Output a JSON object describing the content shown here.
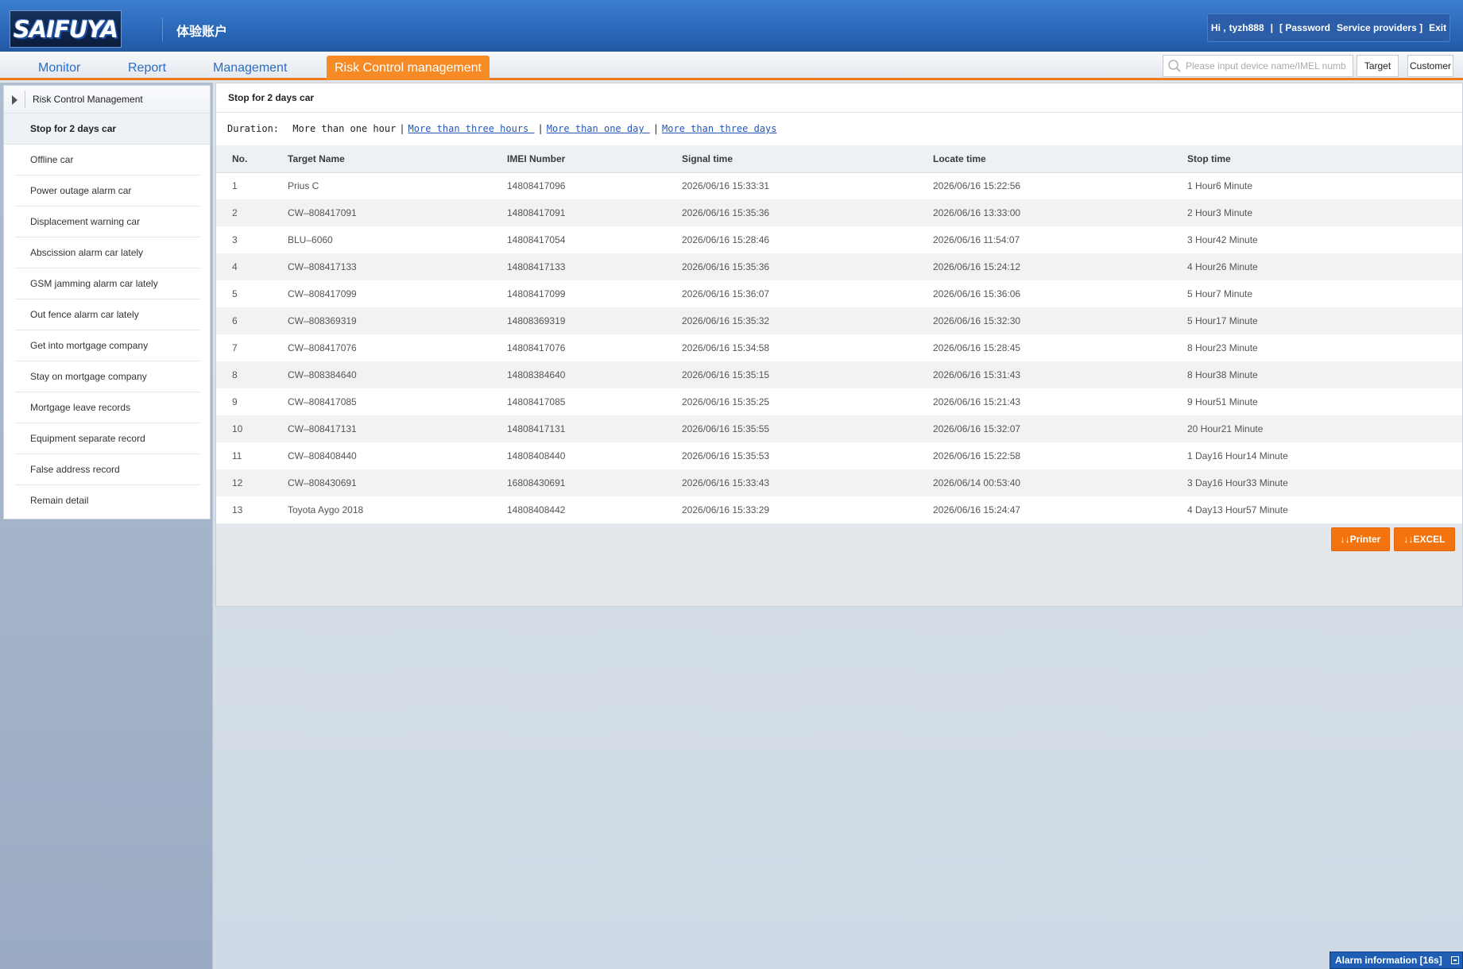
{
  "header": {
    "logo_text": "SAIFUYA",
    "account_name": "体验账户",
    "greeting": "Hi ,",
    "username": "tyzh888",
    "separator": "|",
    "password_link": "[ Password",
    "service_link": "Service providers ]",
    "exit_link": "Exit"
  },
  "nav": {
    "tabs": [
      {
        "label": "Monitor"
      },
      {
        "label": "Report"
      },
      {
        "label": "Management"
      },
      {
        "label": "Risk Control management"
      }
    ],
    "search_placeholder": "Please input device name/IMEL numb",
    "target_button": "Target",
    "customer_button": "Customer"
  },
  "sidebar": {
    "header": "Risk Control Management",
    "items": [
      {
        "label": "Stop for 2 days car"
      },
      {
        "label": "Offline car"
      },
      {
        "label": "Power outage alarm car"
      },
      {
        "label": "Displacement warning car"
      },
      {
        "label": "Abscission alarm car lately"
      },
      {
        "label": "GSM jamming alarm car lately"
      },
      {
        "label": "Out fence alarm car lately"
      },
      {
        "label": "Get into mortgage company"
      },
      {
        "label": "Stay on mortgage company"
      },
      {
        "label": "Mortgage leave records"
      },
      {
        "label": "Equipment separate record"
      },
      {
        "label": "False address record"
      },
      {
        "label": "Remain detail"
      }
    ]
  },
  "main": {
    "title": "Stop for 2 days car",
    "duration_label": "Duration:",
    "duration_options": [
      "More than one hour",
      "More than three hours ",
      "More than one day ",
      "More than three days"
    ],
    "columns": [
      "No.",
      "Target Name",
      "IMEI Number",
      "Signal time",
      "Locate time",
      "Stop time"
    ],
    "rows": [
      [
        "1",
        "Prius C",
        "14808417096",
        "2026/06/16 15:33:31",
        "2026/06/16 15:22:56",
        "1 Hour6 Minute"
      ],
      [
        "2",
        "CW–808417091",
        "14808417091",
        "2026/06/16 15:35:36",
        "2026/06/16 13:33:00",
        "2 Hour3 Minute"
      ],
      [
        "3",
        "BLU–6060",
        "14808417054",
        "2026/06/16 15:28:46",
        "2026/06/16 11:54:07",
        "3 Hour42 Minute"
      ],
      [
        "4",
        "CW–808417133",
        "14808417133",
        "2026/06/16 15:35:36",
        "2026/06/16 15:24:12",
        "4 Hour26 Minute"
      ],
      [
        "5",
        "CW–808417099",
        "14808417099",
        "2026/06/16 15:36:07",
        "2026/06/16 15:36:06",
        "5 Hour7 Minute"
      ],
      [
        "6",
        "CW–808369319",
        "14808369319",
        "2026/06/16 15:35:32",
        "2026/06/16 15:32:30",
        "5 Hour17 Minute"
      ],
      [
        "7",
        "CW–808417076",
        "14808417076",
        "2026/06/16 15:34:58",
        "2026/06/16 15:28:45",
        "8 Hour23 Minute"
      ],
      [
        "8",
        "CW–808384640",
        "14808384640",
        "2026/06/16 15:35:15",
        "2026/06/16 15:31:43",
        "8 Hour38 Minute"
      ],
      [
        "9",
        "CW–808417085",
        "14808417085",
        "2026/06/16 15:35:25",
        "2026/06/16 15:21:43",
        "9 Hour51 Minute"
      ],
      [
        "10",
        "CW–808417131",
        "14808417131",
        "2026/06/16 15:35:55",
        "2026/06/16 15:32:07",
        "20 Hour21 Minute"
      ],
      [
        "11",
        "CW–808408440",
        "14808408440",
        "2026/06/16 15:35:53",
        "2026/06/16 15:22:58",
        "1 Day16 Hour14 Minute"
      ],
      [
        "12",
        "CW–808430691",
        "16808430691",
        "2026/06/16 15:33:43",
        "2026/06/14 00:53:40",
        "3 Day16 Hour33 Minute"
      ],
      [
        "13",
        "Toyota Aygo 2018",
        "14808408442",
        "2026/06/16 15:33:29",
        "2026/06/16 15:24:47",
        "4 Day13 Hour57 Minute"
      ]
    ],
    "printer_button": "↓↓Printer",
    "excel_button": "↓↓EXCEL"
  },
  "alarm": {
    "label": "Alarm information [16s]"
  },
  "colors": {
    "header_blue": "#2a67b8",
    "accent_orange": "#f68b26",
    "link_blue": "#2457b5"
  }
}
